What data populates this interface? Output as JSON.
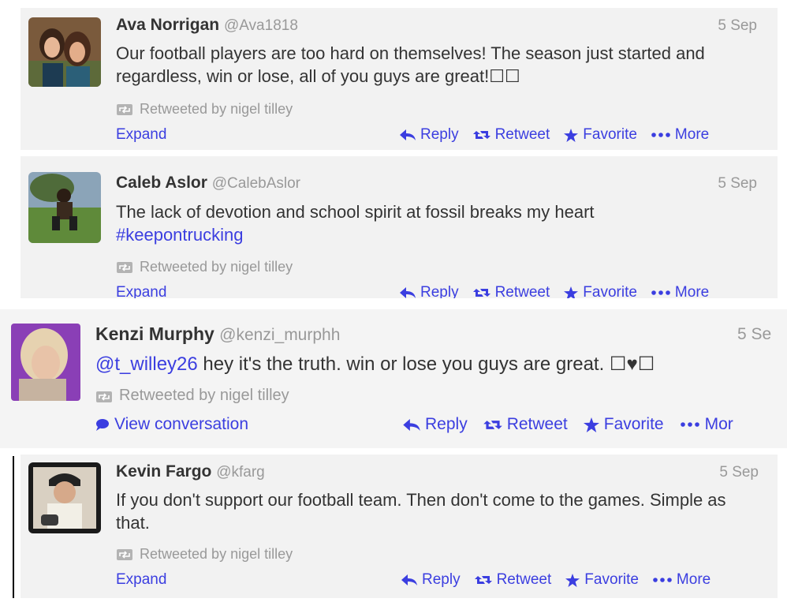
{
  "tweets": [
    {
      "fullname": "Ava Norrigan",
      "username": "@Ava1818",
      "time": "5 Sep",
      "text": "Our football players are too hard on themselves! The season just started and regardless, win or lose, all of you guys are great!☐☐",
      "hashtag": "",
      "retweeted_by": "Retweeted by nigel tilley",
      "expand": "Expand"
    },
    {
      "fullname": "Caleb Aslor",
      "username": "@CalebAslor",
      "time": "5 Sep",
      "text": "The lack of devotion and school spirit at fossil breaks my heart",
      "hashtag": "#keepontrucking",
      "retweeted_by": "Retweeted by nigel tilley",
      "expand": "Expand"
    },
    {
      "fullname": "Kenzi Murphy",
      "username": "@kenzi_murphh",
      "time": "5 Se",
      "mention": "@t_willey26",
      "text": " hey it's the truth. win or lose you guys are great. ☐♥☐",
      "retweeted_by": "Retweeted by nigel tilley",
      "expand": "View conversation"
    },
    {
      "fullname": "Kevin Fargo",
      "username": "@kfarg",
      "time": "5 Sep",
      "text": "If you don't support our football team. Then don't come to the games. Simple as that.",
      "retweeted_by": "Retweeted by nigel tilley",
      "expand": "Expand"
    }
  ],
  "actions": {
    "reply": "Reply",
    "retweet": "Retweet",
    "favorite": "Favorite",
    "more": "More",
    "more_truncated": "Mor"
  },
  "colors": {
    "link": "#3b3ee0",
    "muted": "#999999",
    "text": "#333333",
    "tweet_bg": "#f2f2f2"
  }
}
